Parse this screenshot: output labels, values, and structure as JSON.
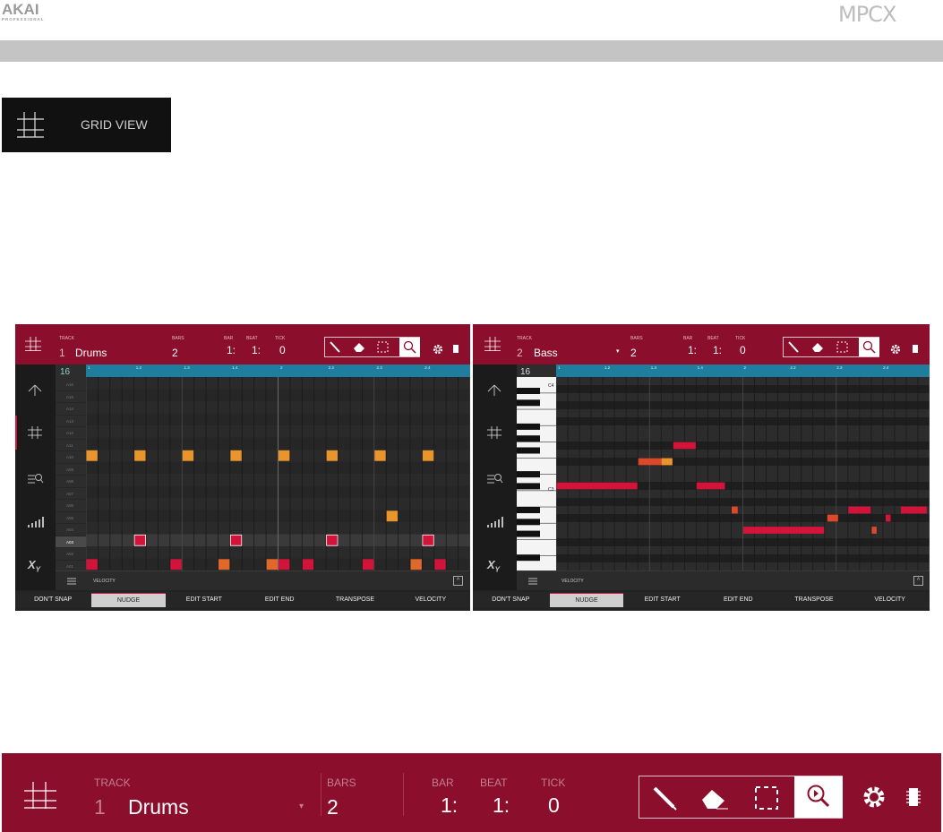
{
  "header": {
    "brand": "AKAI",
    "brand_sub": "PROFESSIONAL",
    "product": "MPCX"
  },
  "grid_view_button": {
    "label": "GRID VIEW",
    "icon": "grid-icon"
  },
  "left_screen": {
    "track_label": "TRACK",
    "track_number": "1",
    "track_name": "Drums",
    "bars_label": "BARS",
    "bars_value": "2",
    "bar_label": "BAR",
    "bar_value": "1:",
    "beat_label": "BEAT",
    "beat_value": "1:",
    "tick_label": "TICK",
    "tick_value": "0",
    "step_count": "16",
    "ruler_ticks": [
      "1",
      "1.2",
      "1.3",
      "1.4",
      "2",
      "2.2",
      "2.3",
      "2.4"
    ],
    "pad_rows": [
      "A16",
      "A15",
      "A14",
      "A13",
      "A12",
      "A11",
      "A10",
      "A09",
      "A08",
      "A07",
      "A06",
      "A05",
      "A04",
      "A03",
      "A02",
      "A01"
    ],
    "selected_pad": "A03",
    "velocity_label": "VELOCITY",
    "softkeys": [
      "DON'T SNAP",
      "NUDGE",
      "EDIT START",
      "EDIT END",
      "TRANSPOSE",
      "VELOCITY"
    ],
    "selected_softkey": "NUDGE"
  },
  "right_screen": {
    "track_label": "TRACK",
    "track_number": "2",
    "track_name": "Bass",
    "bars_label": "BARS",
    "bars_value": "2",
    "bar_label": "BAR",
    "bar_value": "1:",
    "beat_label": "BEAT",
    "beat_value": "1:",
    "tick_label": "TICK",
    "tick_value": "0",
    "step_count": "16",
    "ruler_ticks": [
      "1",
      "1.2",
      "1.3",
      "1.4",
      "2",
      "2.2",
      "2.3",
      "2.4"
    ],
    "key_labels": [
      "C4",
      "C3"
    ],
    "velocity_label": "VELOCITY",
    "softkeys": [
      "DON'T SNAP",
      "NUDGE",
      "EDIT START",
      "EDIT END",
      "TRANSPOSE",
      "VELOCITY"
    ],
    "selected_softkey": "NUDGE"
  },
  "big_toolbar": {
    "track_label": "TRACK",
    "track_number": "1",
    "track_name": "Drums",
    "bars_label": "BARS",
    "bars_value": "2",
    "bar_label": "BAR",
    "bar_value": "1:",
    "beat_label": "BEAT",
    "beat_value": "1:",
    "tick_label": "TICK",
    "tick_value": "0",
    "tools": [
      "pencil-icon",
      "eraser-icon",
      "select-icon",
      "zoom-icon"
    ],
    "selected_tool": "zoom-icon"
  },
  "colors": {
    "maroon": "#8b0f2c",
    "ruler": "#1f7e9e",
    "note_orange": "#e8962c",
    "note_red": "#d2143a",
    "note_redorange": "#d9492a",
    "note_darkorange": "#e0682a"
  }
}
